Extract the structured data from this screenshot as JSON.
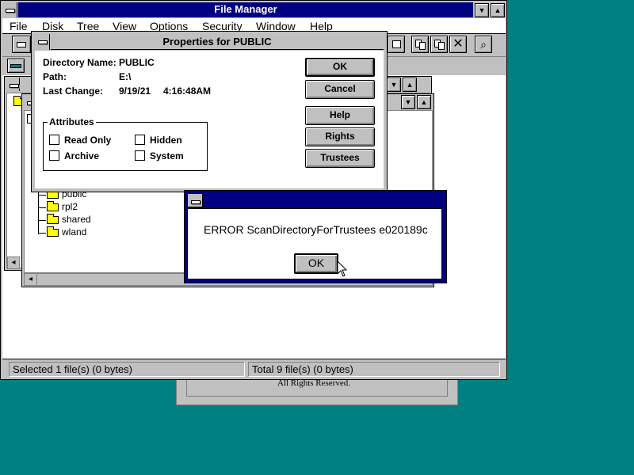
{
  "file_manager": {
    "title": "File Manager",
    "menu": [
      "File",
      "Disk",
      "Tree",
      "View",
      "Options",
      "Security",
      "Window",
      "Help"
    ],
    "status_left": "Selected 1 file(s) (0 bytes)",
    "status_right": "Total 9 file(s) (0 bytes)"
  },
  "tree": {
    "items": [
      "public",
      "rpl2",
      "shared",
      "wland"
    ]
  },
  "background_window": {
    "text": "All Rights Reserved."
  },
  "properties_dialog": {
    "title": "Properties for PUBLIC",
    "directory_name_label": "Directory Name:",
    "directory_name_value": "PUBLIC",
    "path_label": "Path:",
    "path_value": "E:\\",
    "last_change_label": "Last Change:",
    "last_change_date": "9/19/21",
    "last_change_time": "4:16:48AM",
    "attributes_label": "Attributes",
    "attributes": {
      "read_only": "Read Only",
      "archive": "Archive",
      "hidden": "Hidden",
      "system": "System"
    },
    "buttons": {
      "ok": "OK",
      "cancel": "Cancel",
      "help": "Help",
      "rights": "Rights",
      "trustees": "Trustees"
    }
  },
  "error_dialog": {
    "message": "ERROR ScanDirectoryForTrustees e020189c",
    "ok_label": "OK"
  },
  "colors": {
    "desktop": "#008080",
    "title_active": "#000080",
    "face": "#c0c0c0"
  }
}
